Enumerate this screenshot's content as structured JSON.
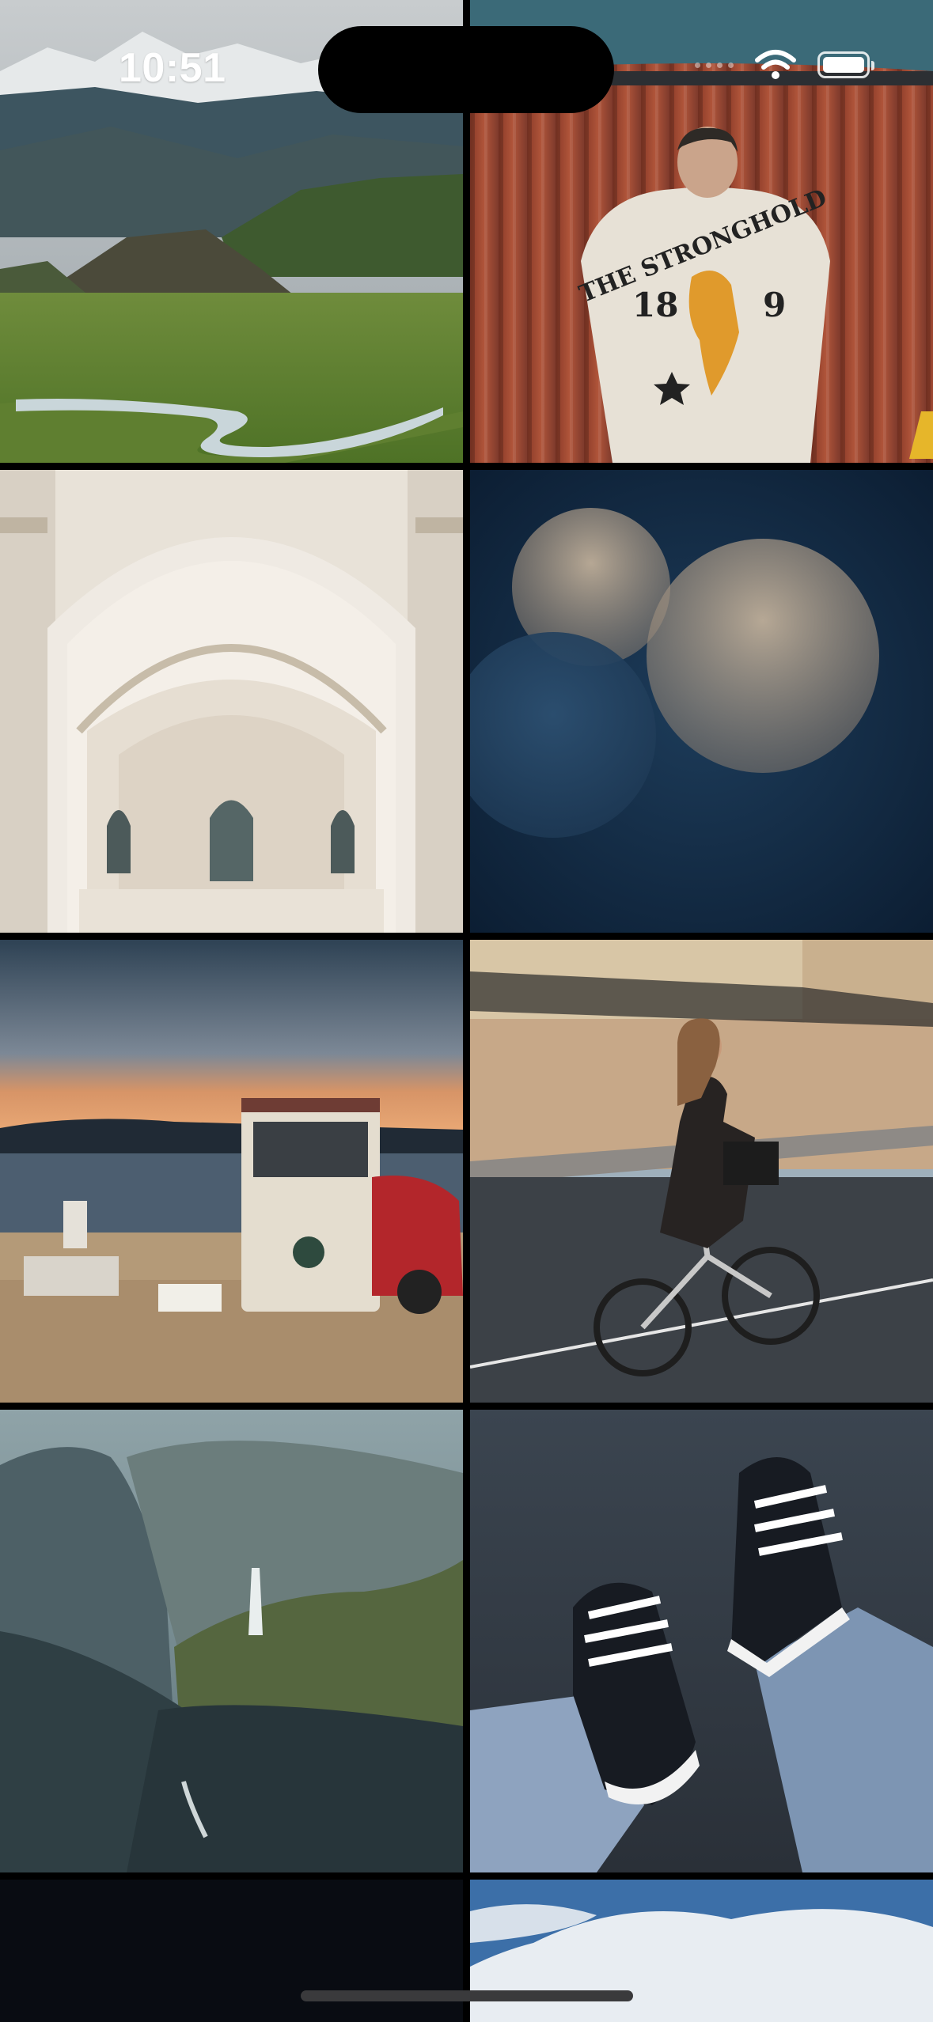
{
  "status_bar": {
    "time": "10:51"
  },
  "gallery": {
    "photos": [
      {
        "id": "mountain-valley"
      },
      {
        "id": "jacket-container"
      },
      {
        "id": "ornate-arch"
      },
      {
        "id": "bokeh-circles"
      },
      {
        "id": "lakeside-camp"
      },
      {
        "id": "cyclist"
      },
      {
        "id": "waterfall-valley"
      },
      {
        "id": "sneakers"
      },
      {
        "id": "dark-partial"
      },
      {
        "id": "sky-partial"
      }
    ]
  },
  "jacket": {
    "line1": "THE STRONGHOLD",
    "left_num": "18",
    "right_num": "9"
  },
  "colors": {
    "background": "#000000",
    "home_indicator": "#3a3a3c"
  }
}
